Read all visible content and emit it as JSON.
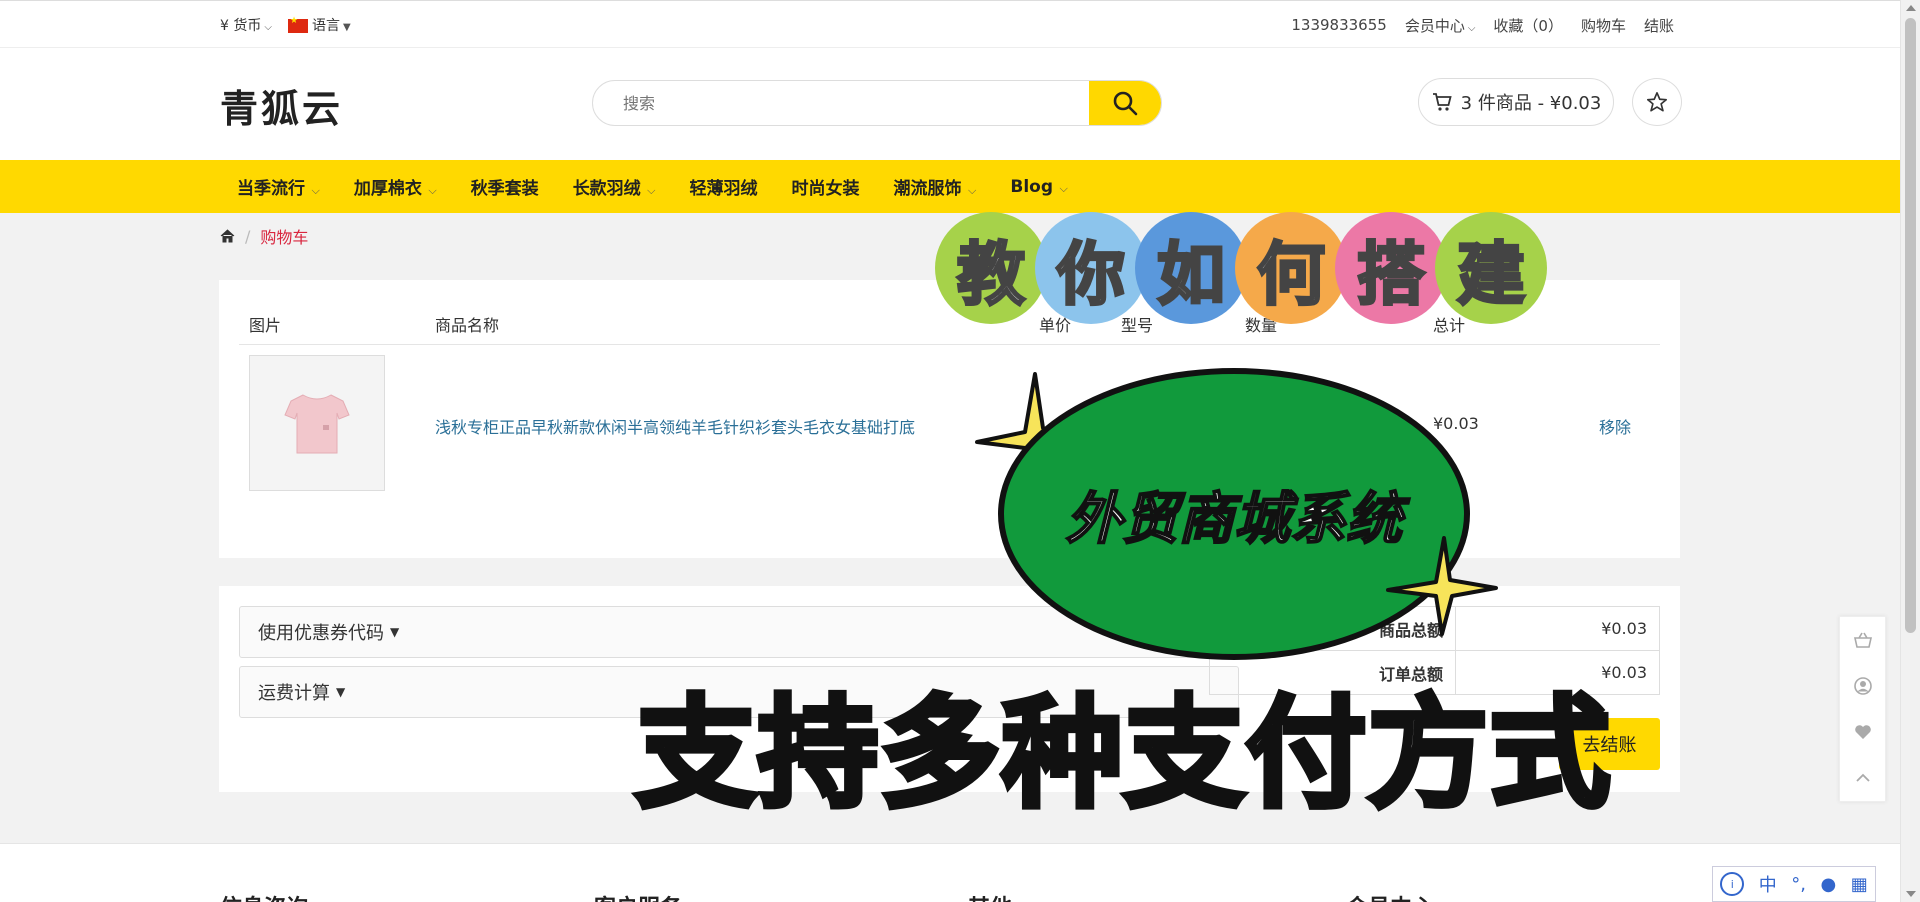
{
  "topbar": {
    "currency_symbol": "¥",
    "currency_label": "货币",
    "language_label": "语言",
    "phone": "1339833655",
    "member_center": "会员中心",
    "favorites": "收藏（0）",
    "cart": "购物车",
    "checkout": "结账"
  },
  "header": {
    "logo": "青狐云",
    "search_placeholder": "搜索",
    "cart_summary": "3 件商品 - ¥0.03"
  },
  "nav": {
    "items": [
      {
        "label": "当季流行",
        "has_caret": true
      },
      {
        "label": "加厚棉衣",
        "has_caret": true
      },
      {
        "label": "秋季套装",
        "has_caret": false
      },
      {
        "label": "长款羽绒",
        "has_caret": true
      },
      {
        "label": "轻薄羽绒",
        "has_caret": false
      },
      {
        "label": "时尚女装",
        "has_caret": false
      },
      {
        "label": "潮流服饰",
        "has_caret": true
      },
      {
        "label": "Blog",
        "has_caret": true
      }
    ]
  },
  "breadcrumb": {
    "home_icon": "home-icon",
    "current": "购物车"
  },
  "cart_table": {
    "headers": {
      "image": "图片",
      "name": "商品名称",
      "unit_price": "单价",
      "model": "型号",
      "quantity": "数量",
      "total": "总计"
    },
    "rows": [
      {
        "name": "浅秋专柜正品早秋新款休闲半高领纯羊毛针织衫套头毛衣女基础打底",
        "total": "¥0.03",
        "remove": "移除"
      }
    ]
  },
  "summary": {
    "coupon_label": "使用优惠券代码",
    "shipping_label": "运费计算",
    "rows": [
      {
        "label": "商品总额",
        "value": "¥0.03"
      },
      {
        "label": "订单总额",
        "value": "¥0.03"
      }
    ],
    "checkout_button": "去结账"
  },
  "footer": {
    "cols": [
      "信息咨询",
      "客户服务",
      "其他",
      "会员中心"
    ]
  },
  "overlay": {
    "circles": [
      "教",
      "你",
      "如",
      "何",
      "搭",
      "建"
    ],
    "circle_colors": [
      "#a6d24a",
      "#8cc4ec",
      "#5a98dc",
      "#f5a94a",
      "#ec78a6",
      "#a6d24a"
    ],
    "oval_text": "外贸商城系统",
    "big_text": "支持多种支付方式"
  },
  "ime": {
    "mode": "中"
  },
  "colors": {
    "accent": "#ffd900",
    "link": "#2a6f97",
    "breadcrumb_active": "#d9263f"
  }
}
